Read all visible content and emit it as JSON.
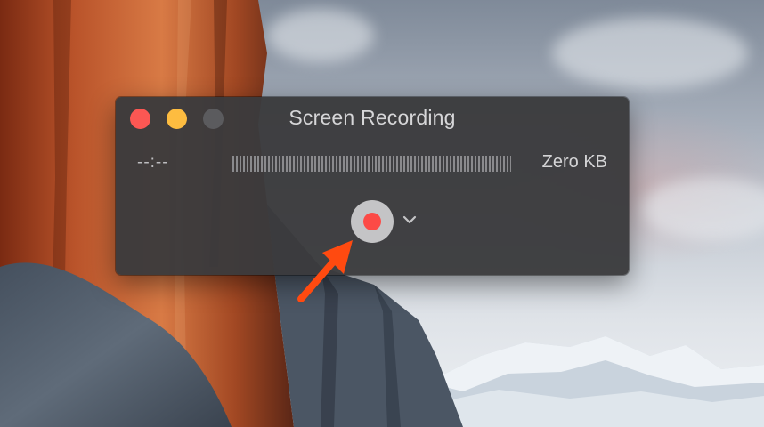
{
  "window": {
    "title": "Screen Recording",
    "timer": "--:--",
    "file_size": "Zero KB"
  },
  "controls": {
    "record_icon": "record-icon",
    "options_icon": "chevron-down-icon"
  },
  "colors": {
    "close": "#fc5753",
    "minimize": "#fdbc40",
    "zoom": "#5b5b5e",
    "record_dot": "#fc4a46",
    "annotation_arrow": "#ff4a10"
  }
}
